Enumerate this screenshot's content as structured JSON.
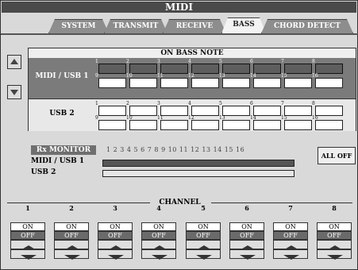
{
  "window": {
    "title": "MIDI"
  },
  "tabs": [
    {
      "label": "SYSTEM"
    },
    {
      "label": "TRANSMIT"
    },
    {
      "label": "RECEIVE"
    },
    {
      "label": "BASS",
      "active": true
    },
    {
      "label": "CHORD DETECT"
    }
  ],
  "bass": {
    "title": "ON BASS NOTE",
    "midi_usb1_label": "MIDI / USB 1",
    "usb2_label": "USB 2",
    "channels": [
      "1",
      "2",
      "3",
      "4",
      "5",
      "6",
      "7",
      "8",
      "9",
      "10",
      "11",
      "12",
      "13",
      "14",
      "15",
      "16"
    ]
  },
  "rx_monitor": {
    "label": "Rx MONITOR",
    "numbers": "1  2  3  4  5  6  7  8  9  10 11 12 13 14 15 16",
    "rows": [
      {
        "label": "MIDI / USB 1"
      },
      {
        "label": "USB 2"
      }
    ]
  },
  "all_off": {
    "label": "ALL OFF"
  },
  "channel_panel": {
    "title": "CHANNEL",
    "channels": [
      {
        "num": "1",
        "on": "ON",
        "off": "OFF"
      },
      {
        "num": "2",
        "on": "ON",
        "off": "OFF"
      },
      {
        "num": "3",
        "on": "ON",
        "off": "OFF"
      },
      {
        "num": "4",
        "on": "ON",
        "off": "OFF"
      },
      {
        "num": "5",
        "on": "ON",
        "off": "OFF"
      },
      {
        "num": "6",
        "on": "ON",
        "off": "OFF"
      },
      {
        "num": "7",
        "on": "ON",
        "off": "OFF"
      },
      {
        "num": "8",
        "on": "ON",
        "off": "OFF"
      }
    ]
  }
}
